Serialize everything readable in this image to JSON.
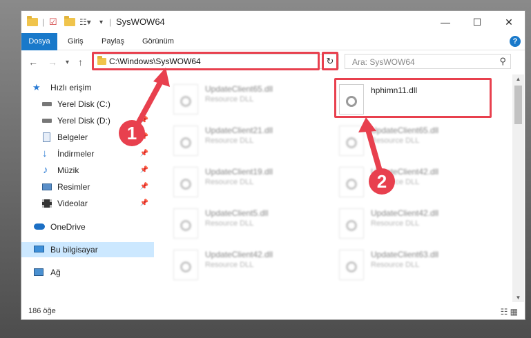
{
  "window": {
    "title": "SysWOW64"
  },
  "ribbon": {
    "tabs": [
      "Dosya",
      "Giriş",
      "Paylaş",
      "Görünüm"
    ],
    "help": "?"
  },
  "nav": {
    "address": "C:\\Windows\\SysWOW64",
    "search_placeholder": "Ara: SysWOW64"
  },
  "sidebar": {
    "items": [
      {
        "label": "Hızlı erişim",
        "icon": "star-icon"
      },
      {
        "label": "Yerel Disk (C:)",
        "icon": "drive-icon"
      },
      {
        "label": "Yerel Disk (D:)",
        "icon": "drive-icon"
      },
      {
        "label": "Belgeler",
        "icon": "documents-icon"
      },
      {
        "label": "İndirmeler",
        "icon": "download-icon"
      },
      {
        "label": "Müzik",
        "icon": "music-icon"
      },
      {
        "label": "Resimler",
        "icon": "pictures-icon"
      },
      {
        "label": "Videolar",
        "icon": "video-icon"
      },
      {
        "label": "OneDrive",
        "icon": "cloud-icon"
      },
      {
        "label": "Bu bilgisayar",
        "icon": "computer-icon"
      },
      {
        "label": "Ağ",
        "icon": "network-icon"
      }
    ]
  },
  "files": [
    {
      "name": "UpdateClient65.dll",
      "type": "Resource DLL"
    },
    {
      "name": "hphimn11.dll",
      "type": ""
    },
    {
      "name": "UpdateClient21.dll",
      "type": "Resource DLL"
    },
    {
      "name": "UpdateClient65.dll",
      "type": "Resource DLL"
    },
    {
      "name": "UpdateClient19.dll",
      "type": "Resource DLL"
    },
    {
      "name": "UpdateClient42.dll",
      "type": "Resource DLL"
    },
    {
      "name": "UpdateClient5.dll",
      "type": "Resource DLL"
    },
    {
      "name": "UpdateClient42.dll",
      "type": "Resource DLL"
    },
    {
      "name": "UpdateClient42.dll",
      "type": "Resource DLL"
    },
    {
      "name": "UpdateClient63.dll",
      "type": "Resource DLL"
    }
  ],
  "status": {
    "count": "186 öğe"
  },
  "annotations": {
    "step1": "1",
    "step2": "2",
    "color": "#e8404e"
  }
}
